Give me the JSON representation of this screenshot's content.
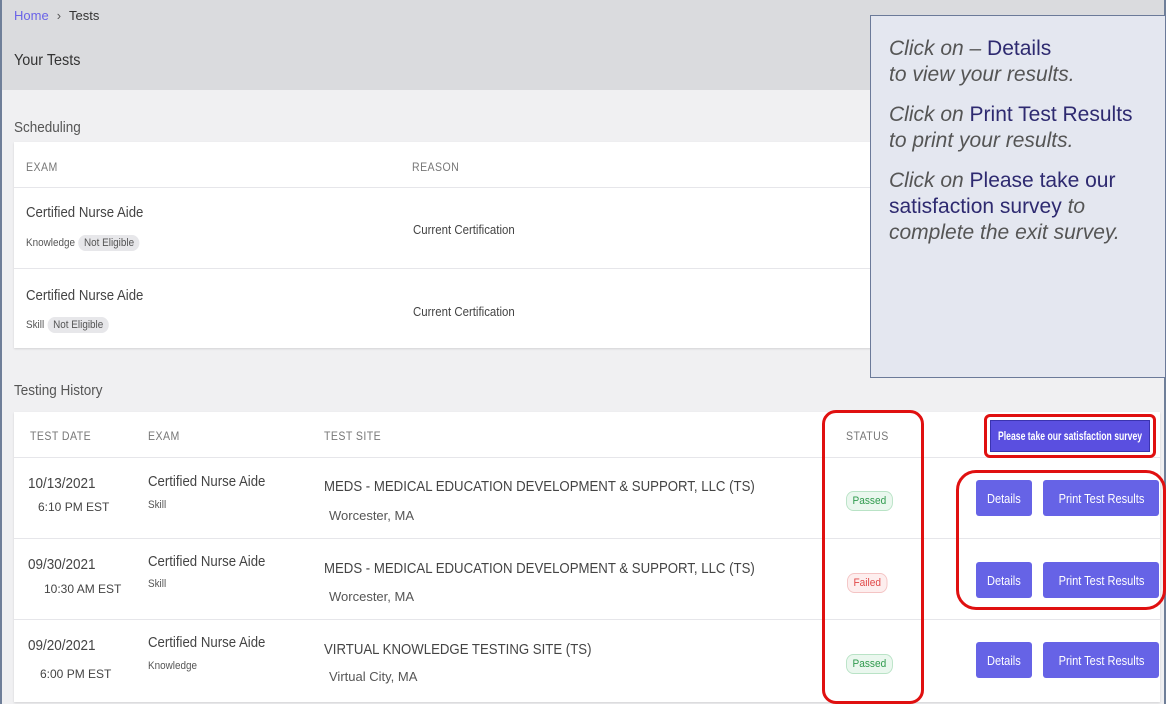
{
  "breadcrumb": {
    "home": "Home",
    "separator": "›",
    "current": "Tests"
  },
  "page_title": "Your Tests",
  "scheduling": {
    "label": "Scheduling",
    "headers": {
      "exam": "EXAM",
      "reason": "REASON"
    },
    "rows": [
      {
        "exam": "Certified Nurse Aide",
        "type": "Knowledge",
        "eligibility": "Not Eligible",
        "reason": "Current Certification"
      },
      {
        "exam": "Certified Nurse Aide",
        "type": "Skill",
        "eligibility": "Not Eligible",
        "reason": "Current Certification"
      }
    ]
  },
  "history": {
    "label": "Testing History",
    "headers": {
      "date": "TEST DATE",
      "exam": "EXAM",
      "site": "TEST SITE",
      "status": "STATUS"
    },
    "survey_button": "Please take our satisfaction survey",
    "rows": [
      {
        "date": "10/13/2021",
        "time": "6:10 PM EST",
        "exam": "Certified Nurse Aide",
        "type": "Skill",
        "site": "MEDS - MEDICAL EDUCATION DEVELOPMENT & SUPPORT, LLC (TS)",
        "city": "Worcester, MA",
        "status": "Passed",
        "details": "Details",
        "print": "Print Test Results"
      },
      {
        "date": "09/30/2021",
        "time": "10:30 AM EST",
        "exam": "Certified Nurse Aide",
        "type": "Skill",
        "site": "MEDS - MEDICAL EDUCATION DEVELOPMENT & SUPPORT, LLC (TS)",
        "city": "Worcester, MA",
        "status": "Failed",
        "details": "Details",
        "print": "Print Test Results"
      },
      {
        "date": "09/20/2021",
        "time": "6:00 PM EST",
        "exam": "Certified Nurse Aide",
        "type": "Knowledge",
        "site": "VIRTUAL KNOWLEDGE TESTING SITE (TS)",
        "city": "Virtual City, MA",
        "status": "Passed",
        "details": "Details",
        "print": "Print Test Results"
      }
    ]
  },
  "callout": {
    "p1_pre": "Click on – ",
    "p1_key": "Details",
    "p1_post": "to view your results.",
    "p2_pre": "Click on ",
    "p2_key": "Print Test Results",
    "p2_post": " to print your results.",
    "p3_pre": "Click on ",
    "p3_key": "Please take our satisfaction survey",
    "p3_post": " to complete the exit survey."
  },
  "colors": {
    "accent": "#6663e6",
    "passed": "#2f9a4d",
    "failed": "#e04848",
    "highlight": "#e01010"
  }
}
